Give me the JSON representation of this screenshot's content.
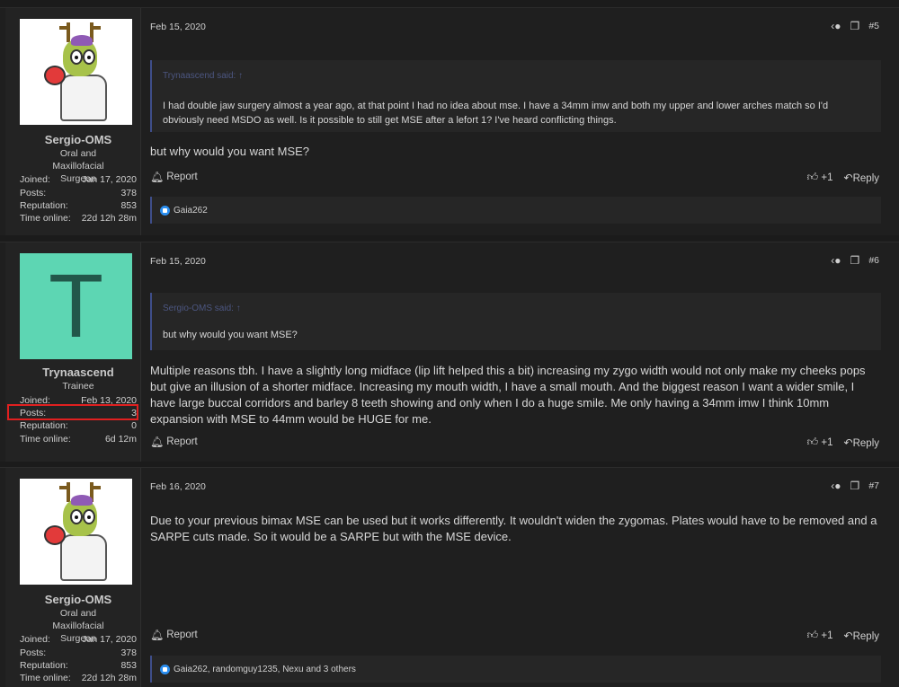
{
  "posts": [
    {
      "user": {
        "name": "Sergio-OMS",
        "title": "Oral and Maxillofacial Surgeon",
        "avatar": "cartoon-reindeer-doctor"
      },
      "stats": [
        {
          "label": "Joined:",
          "value": "Jan 17, 2020"
        },
        {
          "label": "Posts:",
          "value": "378"
        },
        {
          "label": "Reputation:",
          "value": "853"
        },
        {
          "label": "Time online:",
          "value": "22d 12h 28m"
        }
      ],
      "date": "Feb 15, 2020",
      "number": "#5",
      "quote": {
        "author": "Trynaascend said:",
        "text": "I had double jaw surgery almost a year ago, at that point I had no idea about mse. I have a 34mm imw and both my upper and lower arches match so I'd obviously need MSDO as well. Is it possible to still get MSE after a lefort 1? I've heard conflicting things."
      },
      "body": "but why would you want MSE?",
      "report_label": "Report",
      "like_label": "+1",
      "reply_label": "Reply",
      "reactions": "Gaia262"
    },
    {
      "user": {
        "name": "Trynaascend",
        "title": "Trainee",
        "avatar_letter": "T"
      },
      "stats": [
        {
          "label": "Joined:",
          "value": "Feb 13, 2020"
        },
        {
          "label": "Posts:",
          "value": "3"
        },
        {
          "label": "Reputation:",
          "value": "0"
        },
        {
          "label": "Time online:",
          "value": "6d 12m"
        }
      ],
      "date": "Feb 15, 2020",
      "number": "#6",
      "quote": {
        "author": "Sergio-OMS said:",
        "text": "but why would you want MSE?"
      },
      "body": "Multiple reasons tbh. I have a slightly long midface (lip lift helped this a bit) increasing my zygo width would not only make my cheeks pops but give an illusion of a shorter midface. Increasing my mouth width, I have a small mouth. And the biggest reason I want a wider smile, I have large buccal corridors and barley 8 teeth showing and only when I do a huge smile. Me only having a 34mm imw I think 10mm expansion with MSE to 44mm would be HUGE for me.",
      "report_label": "Report",
      "like_label": "+1",
      "reply_label": "Reply"
    },
    {
      "user": {
        "name": "Sergio-OMS",
        "title": "Oral and Maxillofacial Surgeon",
        "avatar": "cartoon-reindeer-doctor"
      },
      "stats": [
        {
          "label": "Joined:",
          "value": "Jan 17, 2020"
        },
        {
          "label": "Posts:",
          "value": "378"
        },
        {
          "label": "Reputation:",
          "value": "853"
        },
        {
          "label": "Time online:",
          "value": "22d 12h 28m"
        }
      ],
      "date": "Feb 16, 2020",
      "number": "#7",
      "body": "Due to your previous bimax MSE can be used but it works differently. It wouldn't widen the zygomas. Plates would have to be removed and a SARPE cuts made. So it would be a SARPE but with the MSE device.",
      "report_label": "Report",
      "like_label": "+1",
      "reply_label": "Reply",
      "reactions": "Gaia262, randomguy1235, Nexu and 3 others"
    }
  ],
  "icons": {
    "share": "share-icon",
    "bookmark": "bookmark-icon",
    "report": "bell-icon",
    "like": "thumbs-up-icon",
    "reply": "reply-icon",
    "quote_expand": "arrow-up-circle-icon"
  },
  "colors": {
    "highlight": "#e02020",
    "like_badge": "#2a8ef0",
    "avatar_letter_bg": "#5dd6b3"
  }
}
